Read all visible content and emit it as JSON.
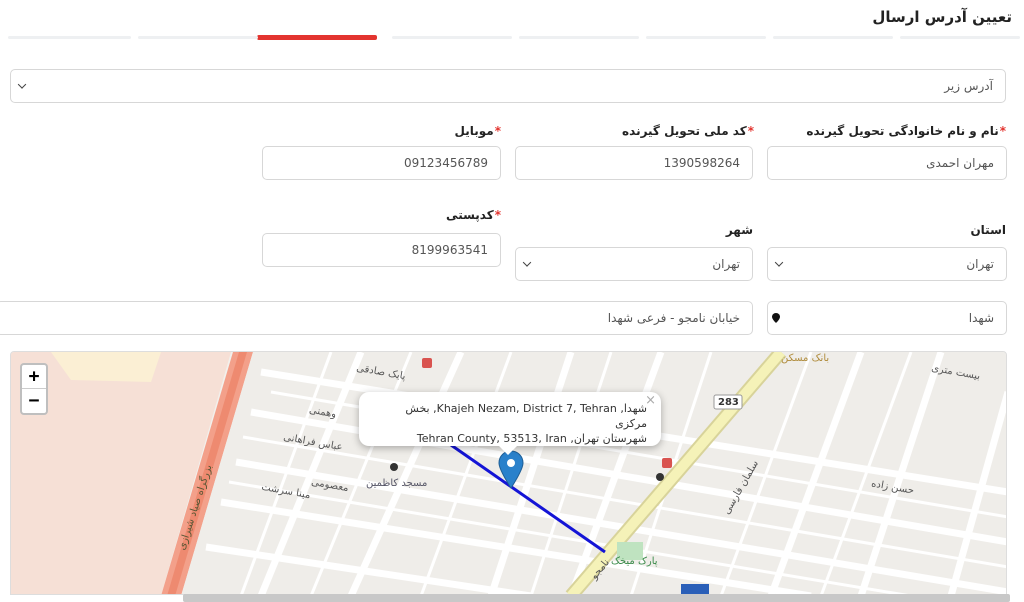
{
  "page_title": "تعیین آدرس ارسال",
  "steps": {
    "count": 8,
    "active_index": 2
  },
  "address_select": {
    "value": "آدرس زیر"
  },
  "fields": {
    "full_name": {
      "label": "نام و نام خانوادگی تحویل گیرنده",
      "required": "*",
      "value": "مهران احمدی"
    },
    "national_code": {
      "label": "کد ملی تحویل گیرنده",
      "required": "*",
      "value": "1390598264"
    },
    "mobile": {
      "label": "موبایل",
      "required": "*",
      "value": "09123456789"
    },
    "province": {
      "label": "استان",
      "value": "تهران"
    },
    "city": {
      "label": "شهر",
      "value": "تهران"
    },
    "postal_code": {
      "label": "کدپستی",
      "required": "*",
      "value": "8199963541"
    },
    "district": {
      "value": "شهدا"
    },
    "street": {
      "value": "خیابان نامجو - فرعی شهدا"
    }
  },
  "map": {
    "zoom_in": "+",
    "zoom_out": "−",
    "popup_line1": "شهدا, Khajeh Nezam, District 7, Tehran, بخش مرکزی",
    "popup_line2": "شهرستان تهران, Tehran County, 53513, Iran",
    "popup_close": "×",
    "road_number": "283",
    "labels": {
      "bank": "بانک مسکن",
      "mosque": "مسجد کاظمین",
      "park": "پارک میخک",
      "highway": "بزرگراه امام علی (ع)",
      "highway2": "بزرگراه صیاد شیرازی",
      "abbas": "عباس فراهانی",
      "mina": "مینا سرشت",
      "hasan": "حسن زاده",
      "salman": "سلمان فارسی",
      "namjou": "نامجو",
      "bast": "بیست متری",
      "sadeghi": "پایک صادقی",
      "vahmani": "وهمنی",
      "masoumi": "معصومی"
    }
  },
  "colors": {
    "accent": "#e3342f",
    "route": "#1414d6",
    "marker": "#2a81cb"
  }
}
